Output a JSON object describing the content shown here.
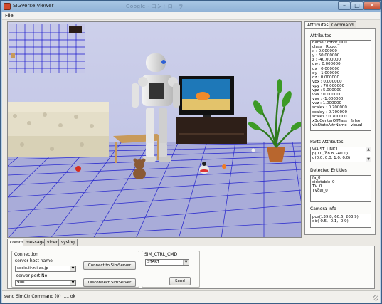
{
  "window": {
    "title": "SIGVerse Viewer",
    "background_title": "Google - コントローラ"
  },
  "menu": {
    "file_label": "File"
  },
  "viewport": {
    "scene": "3d-simulation-view"
  },
  "right_tabs": [
    {
      "label": "Attributes"
    },
    {
      "label": "Command"
    }
  ],
  "attributes": {
    "title": "Attributes",
    "lines": [
      "name : robot_000",
      "class : Robot",
      "x : 0.000000",
      "y : 60.000000",
      "z : -40.000000",
      "qw : 0.000000",
      "qx : 0.000000",
      "qy : 1.000000",
      "qz : 0.000000",
      "vpx : 0.000000",
      "vpy : 70.000000",
      "vpz : 5.000000",
      "vvx : 0.000000",
      "vvy : -1.000000",
      "vvz : 1.000000",
      "scalex : 0.700000",
      "scaley : 0.700000",
      "scalez : 0.700000",
      "x3dCenterOfMass : false",
      "visStateAttrName : visual"
    ]
  },
  "parts_attributes": {
    "title": "Parts Attributes",
    "lines": [
      "WAIST_LINK1",
      "p(0.0, 88.8, -40.0)",
      "q(0.0, 0.0, 1.0, 0.0)"
    ]
  },
  "detected_entities": {
    "title": "Detected Entities",
    "lines": [
      "fa_0",
      "sidetable_0",
      "TV_0",
      "TVdai_0"
    ]
  },
  "camera_info": {
    "title": "Camera Info",
    "lines": [
      "pos(139.8, 60.6, 203.9)",
      "dir(-0.5, -0.1, -0.9)"
    ]
  },
  "bottom_tabs": [
    {
      "label": "comm"
    },
    {
      "label": "messages"
    },
    {
      "label": "video"
    },
    {
      "label": "syslog"
    }
  ],
  "connection": {
    "group_label": "Connection",
    "host_label": "server host name",
    "host_value": "socio.iir.nii.ac.jp",
    "port_label": "server port No",
    "port_value": "9001",
    "connect_label": "Connect to SimServer",
    "disconnect_label": "Disconnect SimServer"
  },
  "sim_ctrl": {
    "group_label": "SIM_CTRL_CMD",
    "command_value": "START",
    "send_label": "Send"
  },
  "status": {
    "text": "send SimCtrlCommand (0) ..... ok"
  },
  "colors": {
    "sky_wall": "#c9cbe8",
    "floor": "#a9acd9",
    "grid": "#1a1acc",
    "title_bar": "#a9c7e4"
  }
}
